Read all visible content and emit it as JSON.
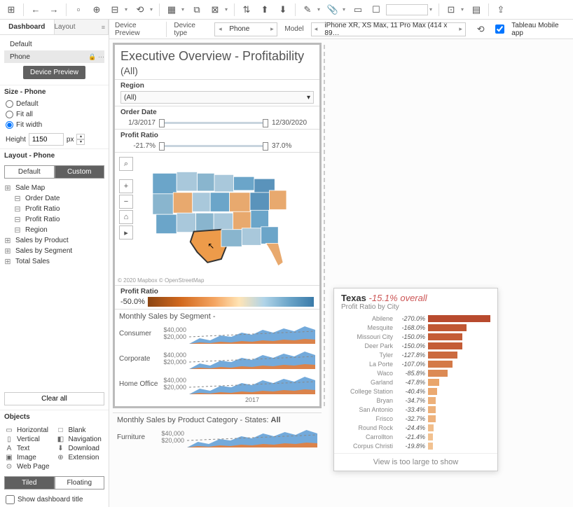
{
  "toolbar": {
    "share_label": "Share"
  },
  "content_bar": {
    "device_preview": "Device Preview",
    "device_type_label": "Device type",
    "device_type_value": "Phone",
    "model_label": "Model",
    "model_value": "iPhone XR, XS Max, 11 Pro Max (414 x 89…",
    "mobile_app_label": "Tableau Mobile app"
  },
  "sidebar": {
    "tabs": {
      "dashboard": "Dashboard",
      "layout": "Layout"
    },
    "default_label": "Default",
    "phone_label": "Phone",
    "device_preview_btn": "Device Preview",
    "size_title": "Size - Phone",
    "size_options": {
      "default": "Default",
      "fit_all": "Fit all",
      "fit_width": "Fit width"
    },
    "height_label": "Height",
    "height_value": "1150",
    "height_unit": "px",
    "layout_title": "Layout - Phone",
    "seg": {
      "default": "Default",
      "custom": "Custom"
    },
    "tree": [
      {
        "icon": "⊞",
        "label": "Sale Map",
        "indent": 0
      },
      {
        "icon": "⊟",
        "label": "Order Date",
        "indent": 1
      },
      {
        "icon": "⊟",
        "label": "Profit Ratio",
        "indent": 1
      },
      {
        "icon": "⊟",
        "label": "Profit Ratio",
        "indent": 1
      },
      {
        "icon": "⊟",
        "label": "Region",
        "indent": 1
      },
      {
        "icon": "⊞",
        "label": "Sales by Product",
        "indent": 0
      },
      {
        "icon": "⊞",
        "label": "Sales by Segment",
        "indent": 0
      },
      {
        "icon": "⊞",
        "label": "Total Sales",
        "indent": 0
      }
    ],
    "clear_all": "Clear all",
    "objects_title": "Objects",
    "objects": [
      {
        "icon": "▭",
        "label": "Horizontal"
      },
      {
        "icon": "□",
        "label": "Blank"
      },
      {
        "icon": "▯",
        "label": "Vertical"
      },
      {
        "icon": "◧",
        "label": "Navigation"
      },
      {
        "icon": "A",
        "label": "Text"
      },
      {
        "icon": "⬇",
        "label": "Download"
      },
      {
        "icon": "▣",
        "label": "Image"
      },
      {
        "icon": "⊕",
        "label": "Extension"
      },
      {
        "icon": "⊙",
        "label": "Web Page"
      }
    ],
    "tiled": "Tiled",
    "floating": "Floating",
    "show_title": "Show dashboard title"
  },
  "dashboard": {
    "title": "Executive Overview - Profitability",
    "subtitle": "(All)",
    "region_label": "Region",
    "region_value": "(All)",
    "order_date_label": "Order Date",
    "order_date_from": "1/3/2017",
    "order_date_to": "12/30/2020",
    "profit_ratio_label": "Profit Ratio",
    "profit_ratio_from": "-21.7%",
    "profit_ratio_to": "37.0%",
    "map_attribution": "© 2020 Mapbox © OpenStreetMap",
    "legend_label": "Profit Ratio",
    "legend_min": "-50.0%",
    "segment_title": "Monthly Sales by Segment -",
    "segments": [
      "Consumer",
      "Corporate",
      "Home Office"
    ],
    "yvals": [
      "$40,000",
      "$20,000"
    ],
    "years": [
      "2017"
    ],
    "product_title": "Monthly Sales by Product Category - States: ",
    "product_title_bold": "All",
    "products": [
      "Furniture"
    ]
  },
  "tooltip": {
    "state": "Texas",
    "overall": "-15.1% overall",
    "subtitle": "Profit Ratio by City",
    "footer": "View is too large to show"
  },
  "chart_data": {
    "type": "bar",
    "title": "Profit Ratio by City",
    "xlabel": "Profit Ratio",
    "ylabel": "City",
    "series": [
      {
        "name": "Profit Ratio",
        "values": [
          -270.0,
          -168.0,
          -150.0,
          -150.0,
          -127.8,
          -107.0,
          -85.8,
          -47.8,
          -40.4,
          -34.7,
          -33.4,
          -32.7,
          -24.4,
          -21.4,
          -19.8
        ]
      }
    ],
    "categories": [
      "Abilene",
      "Mesquite",
      "Missouri City",
      "Deer Park",
      "Tyler",
      "La Porte",
      "Waco",
      "Garland",
      "College Station",
      "Bryan",
      "San Antonio",
      "Frisco",
      "Round Rock",
      "Carrollton",
      "Corpus Christi"
    ],
    "xlim": [
      -300,
      0
    ],
    "display_values": [
      "-270.0%",
      "-168.0%",
      "-150.0%",
      "-150.0%",
      "-127.8%",
      "-107.0%",
      "-85.8%",
      "-47.8%",
      "-40.4%",
      "-34.7%",
      "-33.4%",
      "-32.7%",
      "-24.4%",
      "-21.4%",
      "-19.8%"
    ],
    "bar_colors": [
      "#b84a2e",
      "#c05733",
      "#c45c36",
      "#c45c36",
      "#cb6a3f",
      "#d47a48",
      "#dc8a54",
      "#e9a56a",
      "#eba970",
      "#edb079",
      "#edb17a",
      "#eeb27c",
      "#f1bd8a",
      "#f2c190",
      "#f2c292"
    ]
  }
}
